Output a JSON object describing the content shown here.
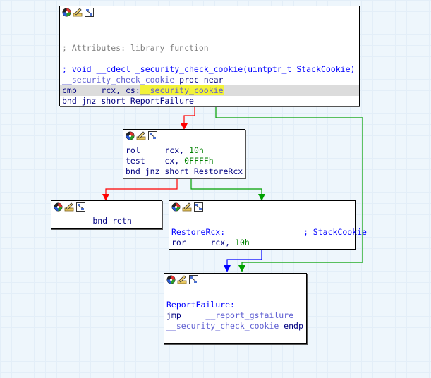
{
  "nodes": [
    {
      "id": "entry",
      "lines": [
        {
          "parts": [
            {
              "t": "",
              "c": "c-plain"
            }
          ]
        },
        {
          "parts": [
            {
              "t": "",
              "c": "c-plain"
            }
          ]
        },
        {
          "parts": [
            {
              "t": "; Attributes: library function",
              "c": "c-comment"
            }
          ]
        },
        {
          "parts": [
            {
              "t": "",
              "c": "c-plain"
            }
          ]
        },
        {
          "parts": [
            {
              "t": "; void __cdecl _security_check_cookie(uintptr_t StackCookie)",
              "c": "c-blue"
            }
          ]
        },
        {
          "parts": [
            {
              "t": "__security_check_cookie",
              "c": "c-imp"
            },
            {
              "t": " proc near",
              "c": "c-navy"
            }
          ]
        },
        {
          "hl": true,
          "parts": [
            {
              "t": "cmp     rcx, cs:",
              "c": "c-navy"
            },
            {
              "t": "__secu",
              "c": "c-imp yhl"
            },
            {
              "cursor": true
            },
            {
              "t": "rity_cookie",
              "c": "c-imp yhl"
            }
          ]
        },
        {
          "parts": [
            {
              "t": "bnd jnz short ReportFailure",
              "c": "c-navy"
            }
          ]
        }
      ]
    },
    {
      "id": "rol",
      "lines": [
        {
          "parts": [
            {
              "t": "rol     rcx, ",
              "c": "c-navy"
            },
            {
              "t": "10h",
              "c": "c-green"
            }
          ]
        },
        {
          "parts": [
            {
              "t": "test    cx, ",
              "c": "c-navy"
            },
            {
              "t": "0FFFFh",
              "c": "c-green"
            }
          ]
        },
        {
          "parts": [
            {
              "t": "bnd jnz short RestoreRcx",
              "c": "c-navy"
            }
          ]
        }
      ]
    },
    {
      "id": "retn",
      "lines": [
        {
          "parts": [
            {
              "t": "        bnd retn",
              "c": "c-navy"
            }
          ]
        }
      ]
    },
    {
      "id": "restore",
      "lines": [
        {
          "parts": [
            {
              "t": "",
              "c": "c-plain"
            }
          ]
        },
        {
          "parts": [
            {
              "t": "RestoreRcx:",
              "c": "c-blue"
            },
            {
              "t": "                ; StackCookie",
              "c": "c-blue"
            }
          ]
        },
        {
          "parts": [
            {
              "t": "ror     rcx, ",
              "c": "c-navy"
            },
            {
              "t": "10h",
              "c": "c-green"
            }
          ]
        }
      ]
    },
    {
      "id": "report",
      "lines": [
        {
          "parts": [
            {
              "t": "",
              "c": "c-plain"
            }
          ]
        },
        {
          "parts": [
            {
              "t": "ReportFailure:",
              "c": "c-blue"
            }
          ]
        },
        {
          "parts": [
            {
              "t": "jmp     ",
              "c": "c-navy"
            },
            {
              "t": "__report_gsfailure",
              "c": "c-imp"
            }
          ]
        },
        {
          "parts": [
            {
              "t": "__security_check_cookie",
              "c": "c-imp"
            },
            {
              "t": " endp",
              "c": "c-navy"
            }
          ]
        }
      ]
    }
  ],
  "header_icons": [
    "color-picker-icon",
    "rename-icon",
    "graph-icon"
  ],
  "edge_colors": {
    "true_branch": "#00a000",
    "false_branch": "#ff0000",
    "unconditional": "#0000ff"
  }
}
